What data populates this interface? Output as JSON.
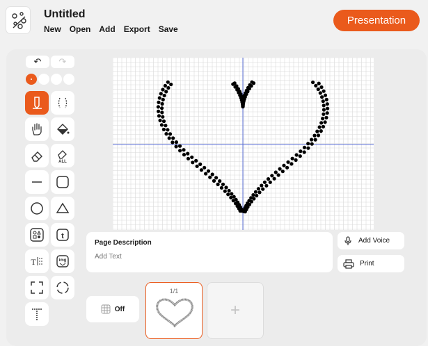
{
  "header": {
    "title": "Untitled",
    "menu": [
      "New",
      "Open",
      "Add",
      "Export",
      "Save"
    ],
    "presentation_label": "Presentation"
  },
  "colors": {
    "accent": "#ea5a1c",
    "grid_line": "#d9d9d9",
    "axis_line": "#5b6fd6",
    "dot": "#000000"
  },
  "toolbar": {
    "undo_icon": "undo-icon",
    "redo_icon": "redo-icon",
    "sizes": [
      "small",
      "medium",
      "large",
      "x-large"
    ],
    "tools": [
      "pen",
      "curve",
      "hand",
      "fill",
      "eraser",
      "erase-all",
      "line",
      "rounded-rect",
      "circle",
      "triangle",
      "grid-pattern",
      "text-t",
      "text-dots",
      "image",
      "select-square",
      "select-circle",
      "dotted-t"
    ]
  },
  "description": {
    "title": "Page Description",
    "placeholder": "Add Text"
  },
  "actions": {
    "add_voice": "Add Voice",
    "print": "Print"
  },
  "grid_toggle": {
    "label": "Off"
  },
  "pages": {
    "counter": "1/1"
  }
}
